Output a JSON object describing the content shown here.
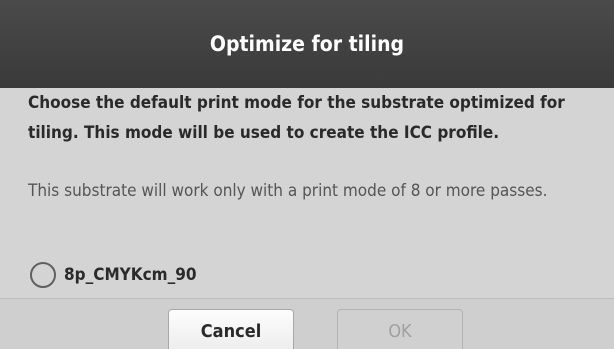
{
  "dialog": {
    "title": "Optimize for tiling",
    "message_primary": "Choose the default print mode for the substrate optimized for tiling. This mode will be used to create the ICC profile.",
    "message_secondary": "This substrate will work only with a print mode of 8 or more passes.",
    "options": [
      {
        "label": "8p_CMYKcm_90",
        "selected": false
      }
    ]
  },
  "footer": {
    "cancel_label": "Cancel",
    "ok_label": "OK",
    "ok_enabled": false
  }
}
